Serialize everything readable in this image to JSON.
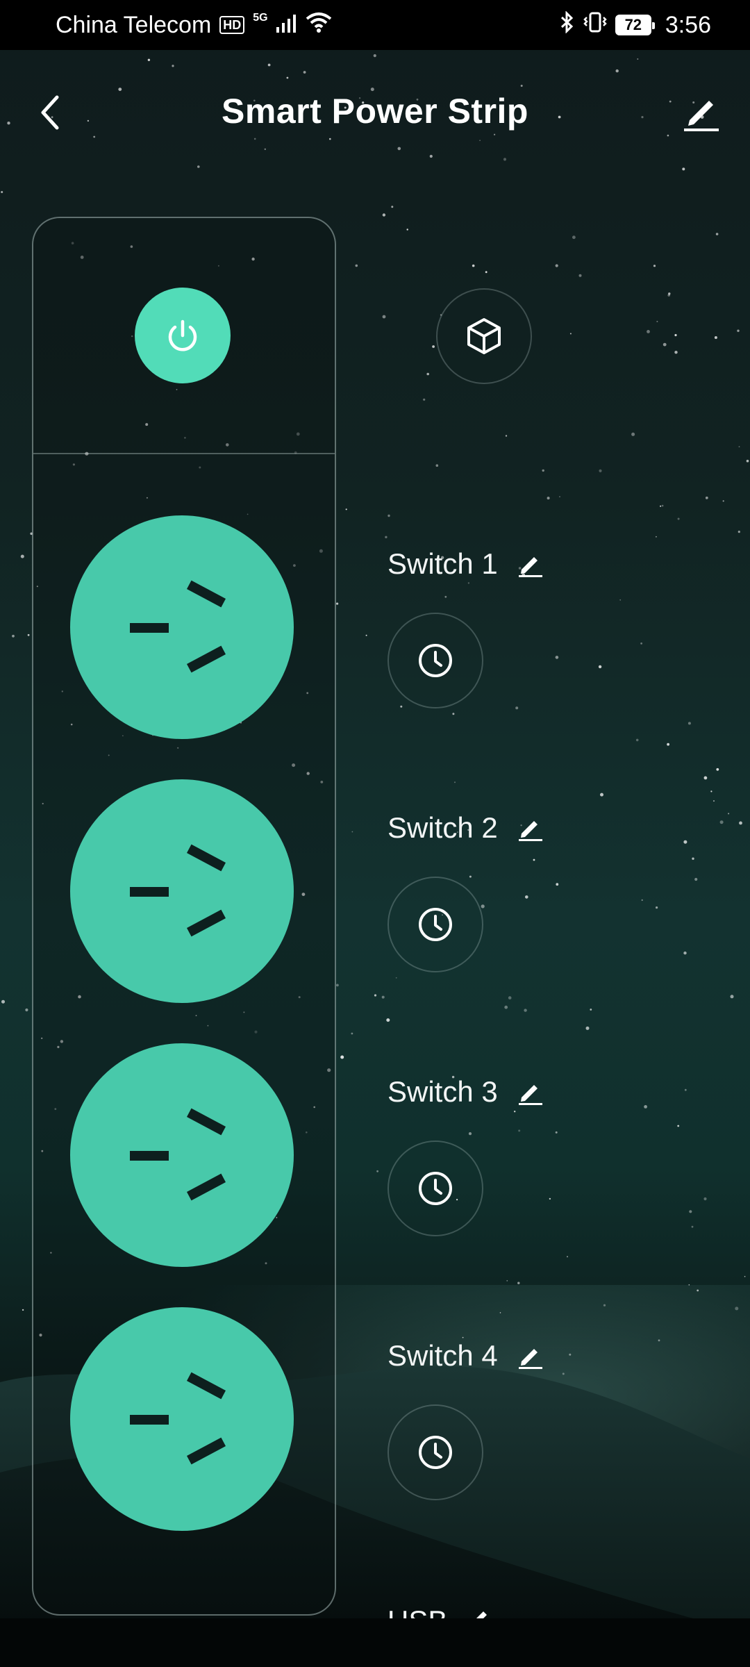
{
  "status_bar": {
    "carrier": "China Telecom",
    "hd_badge": "HD",
    "network": "5G",
    "battery_level": "72",
    "time": "3:56"
  },
  "header": {
    "title": "Smart Power Strip",
    "back_icon": "chevron-left-icon",
    "edit_icon": "pencil-icon"
  },
  "master": {
    "icon": "power-icon",
    "state": "on"
  },
  "scene": {
    "icon": "cube-icon"
  },
  "switches": [
    {
      "label": "Switch 1",
      "state": "on"
    },
    {
      "label": "Switch 2",
      "state": "on"
    },
    {
      "label": "Switch 3",
      "state": "on"
    },
    {
      "label": "Switch 4",
      "state": "on"
    }
  ],
  "usb": {
    "label": "USB"
  },
  "colors": {
    "accent": "#52dcb8",
    "socket": "#48c9aa",
    "background": "#112322"
  }
}
